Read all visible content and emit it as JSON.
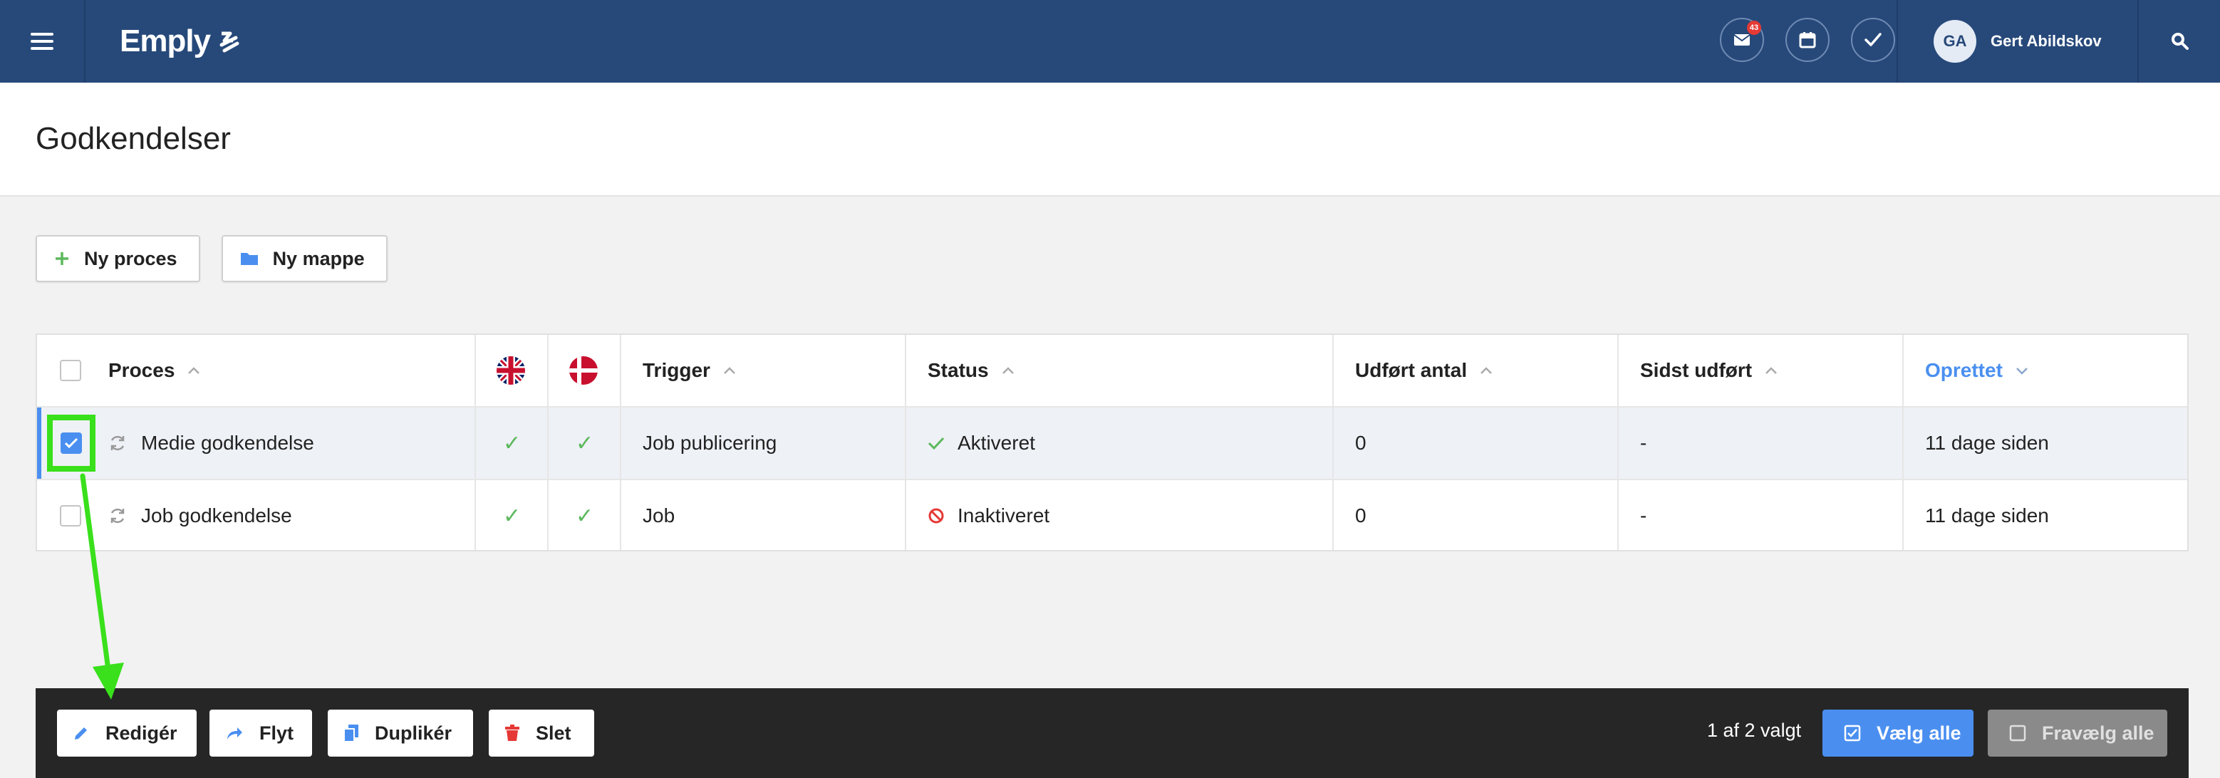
{
  "topbar": {
    "brand": "Emply",
    "notification_count": "43",
    "user_initials": "GA",
    "user_name": "Gert Abildskov",
    "color": "#27497a"
  },
  "page": {
    "title": "Godkendelser"
  },
  "actions": {
    "new_process": "Ny proces",
    "new_folder": "Ny mappe"
  },
  "table": {
    "columns": {
      "process": "Proces",
      "trigger": "Trigger",
      "status": "Status",
      "done_count": "Udført antal",
      "last_done": "Sidst udført",
      "created": "Oprettet"
    },
    "rows": [
      {
        "selected": true,
        "name": "Medie godkendelse",
        "en": "✓",
        "da": "✓",
        "trigger": "Job publicering",
        "status": "Aktiveret",
        "status_icon": "check-icon",
        "done_count": "0",
        "last_done": "-",
        "created": "11 dage siden"
      },
      {
        "selected": false,
        "name": "Job godkendelse",
        "en": "✓",
        "da": "✓",
        "trigger": "Job",
        "status": "Inaktiveret",
        "status_icon": "blocked-icon",
        "done_count": "0",
        "last_done": "-",
        "created": "11 dage siden"
      }
    ]
  },
  "bottombar": {
    "edit": "Redigér",
    "move": "Flyt",
    "duplicate": "Duplikér",
    "delete": "Slet",
    "selected_count": "1 af 2 valgt",
    "select_all": "Vælg alle",
    "deselect_all": "Fravælg alle"
  },
  "colors": {
    "accent": "#4a8ff0",
    "success": "#5cb85c",
    "danger": "#e53935",
    "highlight": "#39e01b"
  }
}
